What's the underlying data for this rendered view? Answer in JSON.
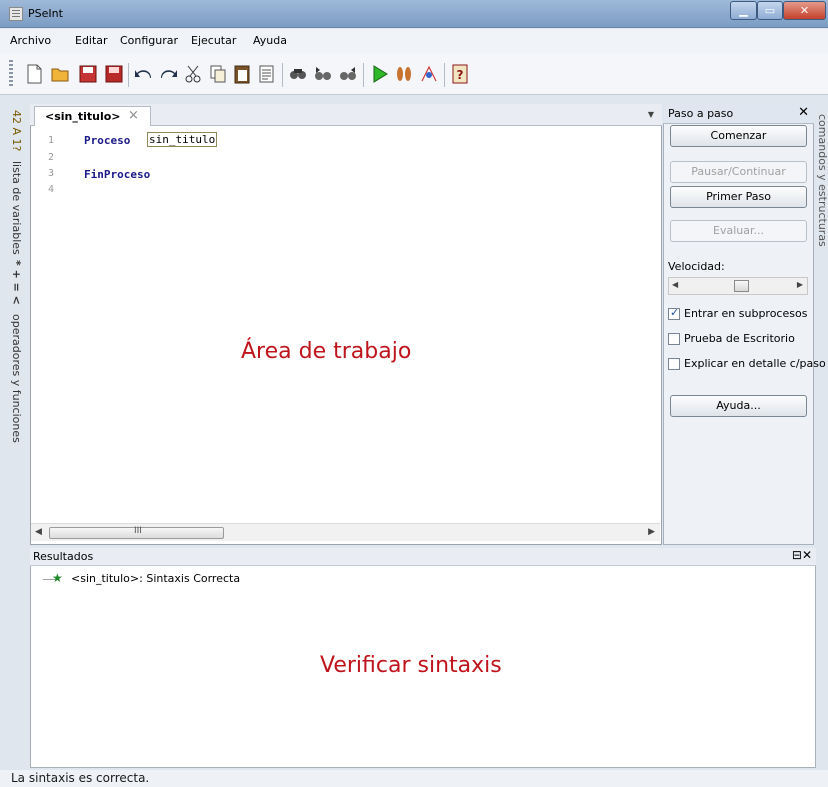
{
  "window": {
    "title": "PSeInt"
  },
  "menu": [
    "Archivo",
    "Editar",
    "Configurar",
    "Ejecutar",
    "Ayuda"
  ],
  "toolbar": {
    "icons": [
      "new-file-icon",
      "open-folder-icon",
      "save-icon",
      "save-as-icon",
      "undo-icon",
      "redo-icon",
      "cut-icon",
      "copy-icon",
      "paste-icon",
      "format-icon",
      "find-icon",
      "find-prev-icon",
      "find-next-icon",
      "run-icon",
      "step-icon",
      "diagram-icon",
      "help-icon"
    ]
  },
  "left_tabs": {
    "variables": "lista de variables",
    "variables_symbols": "42 A 1?",
    "operators": "operadores y funciones",
    "operators_symbols": "* + = <"
  },
  "right_tab": {
    "label": "comandos y estructuras"
  },
  "editor": {
    "tab_label": "<sin_titulo>",
    "lines": [
      {
        "num": "1",
        "keyword": "Proceso",
        "ident": "sin_titulo"
      },
      {
        "num": "2",
        "keyword": "",
        "ident": ""
      },
      {
        "num": "3",
        "keyword": "FinProceso",
        "ident": ""
      },
      {
        "num": "4",
        "keyword": "",
        "ident": ""
      }
    ],
    "caption": "Área de trabajo",
    "scroll_grip": "III"
  },
  "step_panel": {
    "title": "Paso a paso",
    "buttons": {
      "comenzar": "Comenzar",
      "pausar": "Pausar/Continuar",
      "primer_paso": "Primer Paso",
      "evaluar": "Evaluar...",
      "ayuda": "Ayuda..."
    },
    "speed_label": "Velocidad:",
    "speed_value": 0.5,
    "checkboxes": [
      {
        "label": "Entrar en subprocesos",
        "checked": true
      },
      {
        "label": "Prueba de Escritorio",
        "checked": false
      },
      {
        "label": "Explicar en detalle c/paso",
        "checked": false
      }
    ]
  },
  "results": {
    "title": "Resultados",
    "entry": "<sin_titulo>: Sintaxis Correcta",
    "caption": "Verificar sintaxis"
  },
  "status": {
    "text": "La sintaxis es correcta."
  },
  "colors": {
    "caption": "#c0141c",
    "keyword": "#1a1a8a",
    "star": "#1f8a2a"
  }
}
